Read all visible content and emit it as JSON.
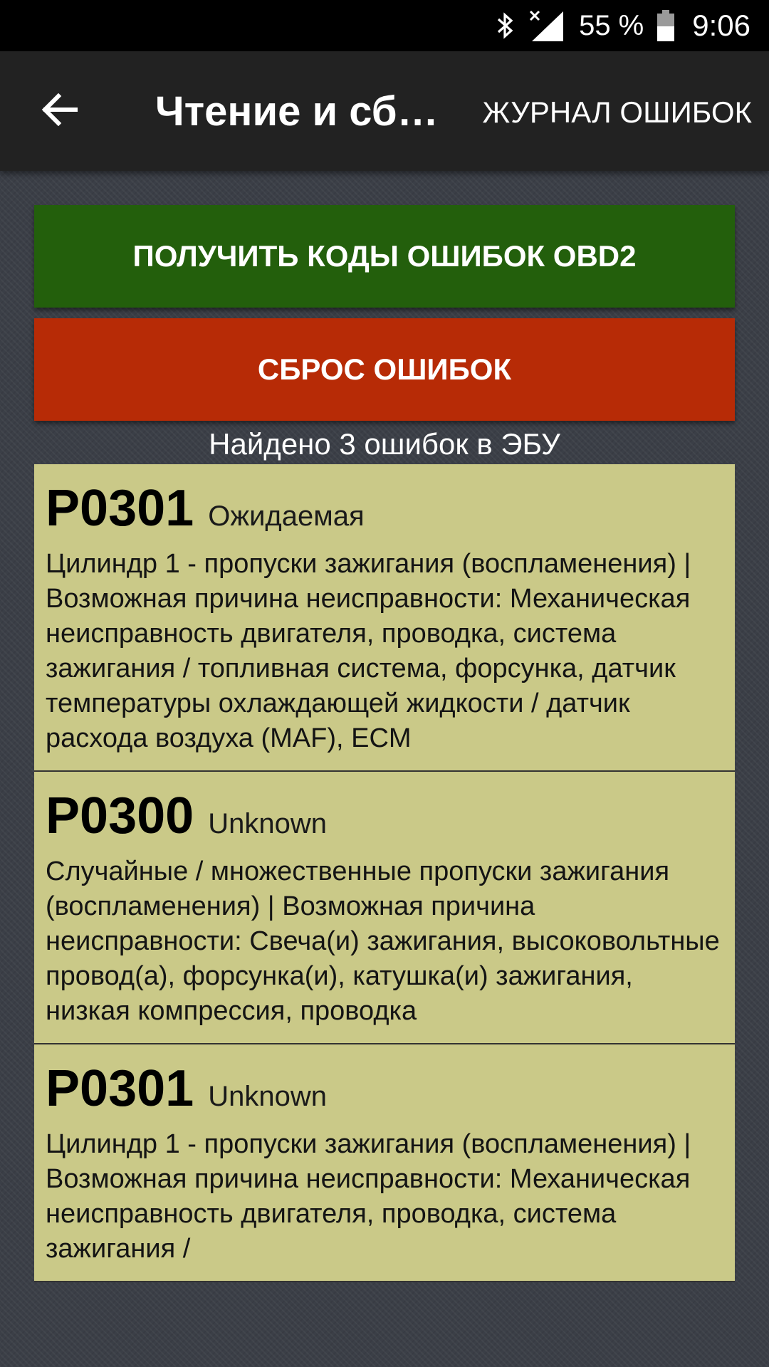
{
  "status_bar": {
    "battery_percent": "55 %",
    "time": "9:06",
    "icons": [
      "bluetooth-icon",
      "signal-icon",
      "battery-icon"
    ]
  },
  "app_bar": {
    "title": "Чтение и сбр...",
    "log_button": "ЖУРНАЛ ОШИБОК"
  },
  "buttons": {
    "read_codes": "ПОЛУЧИТЬ КОДЫ ОШИБОК OBD2",
    "reset": "СБРОС ОШИБОК"
  },
  "found_text": "Найдено 3 ошибок в ЭБУ",
  "errors": [
    {
      "code": "P0301",
      "status": "Ожидаемая",
      "description": "Цилиндр 1 - пропуски зажигания (воспламенения) | Возможная причина неисправности: Механическая неисправность двигателя, проводка, система зажигания / топливная система, форсунка, датчик температуры охлаждающей жидкости / датчик расхода воздуха (MAF), ECM"
    },
    {
      "code": "P0300",
      "status": "Unknown",
      "description": "Случайные / множественные пропуски зажигания (воспламенения) | Возможная причина неисправности: Свеча(и) зажигания, высоковольтные провод(а), форсунка(и), катушка(и) зажигания, низкая компрессия, проводка"
    },
    {
      "code": "P0301",
      "status": "Unknown",
      "description": "Цилиндр 1 - пропуски зажигания (воспламенения) | Возможная причина неисправности: Механическая неисправность двигателя, проводка, система зажигания /"
    }
  ],
  "colors": {
    "read_button": "#235f0c",
    "reset_button": "#b72b06",
    "card_background": "#cac988",
    "app_bar": "#222222"
  }
}
